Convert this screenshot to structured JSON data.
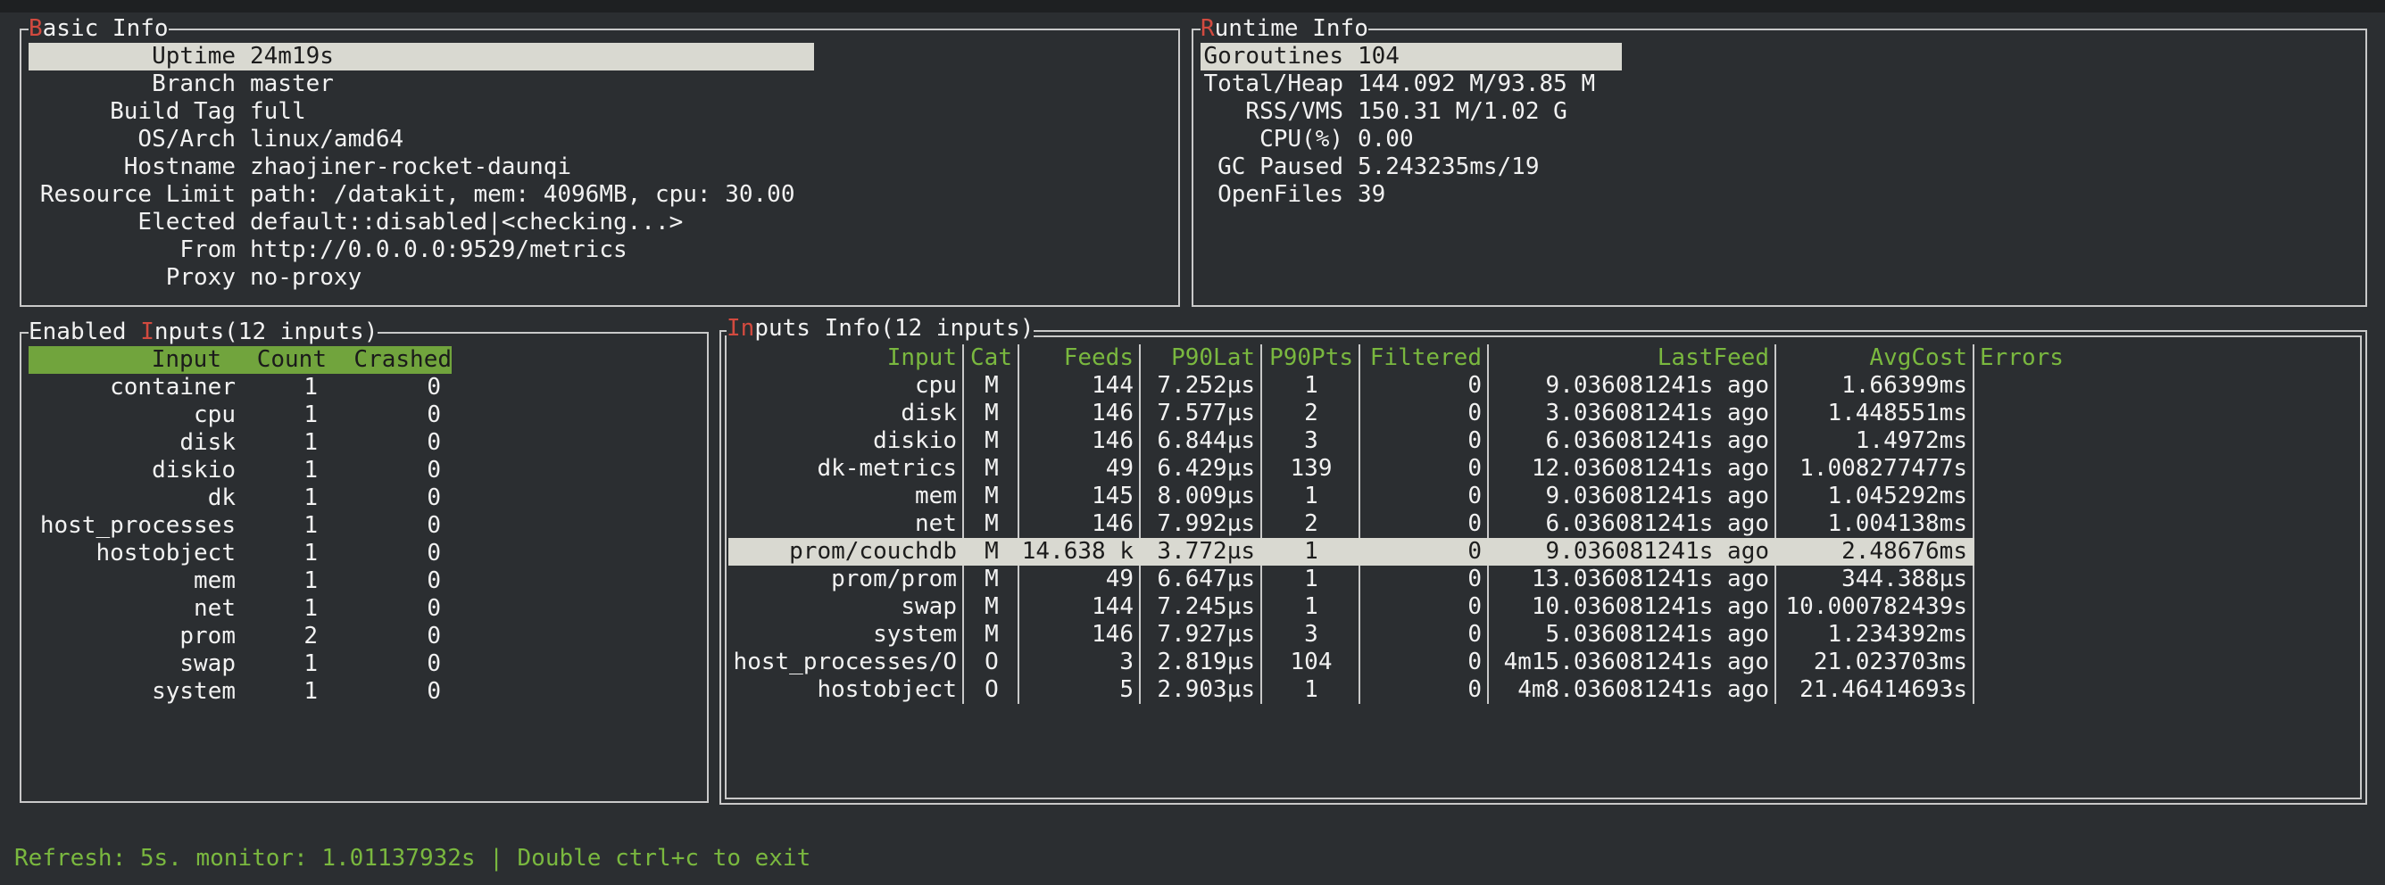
{
  "basic_info": {
    "title_hot": "B",
    "title_rest": "asic Info",
    "rows": [
      {
        "label": "Uptime",
        "value": "24m19s"
      },
      {
        "label": "Branch",
        "value": "master"
      },
      {
        "label": "Build Tag",
        "value": "full"
      },
      {
        "label": "OS/Arch",
        "value": "linux/amd64"
      },
      {
        "label": "Hostname",
        "value": "zhaojiner-rocket-daunqi"
      },
      {
        "label": "Resource Limit",
        "value": "path: /datakit, mem: 4096MB, cpu: 30.00"
      },
      {
        "label": "Elected",
        "value": "default::disabled|<checking...>"
      },
      {
        "label": "From",
        "value": "http://0.0.0.0:9529/metrics"
      },
      {
        "label": "Proxy",
        "value": "no-proxy"
      }
    ]
  },
  "runtime_info": {
    "title_hot": "R",
    "title_rest": "untime Info",
    "rows": [
      {
        "label": "Goroutines",
        "value": "104"
      },
      {
        "label": "Total/Heap",
        "value": "144.092 M/93.85 M"
      },
      {
        "label": "RSS/VMS",
        "value": "150.31 M/1.02 G"
      },
      {
        "label": "CPU(%)",
        "value": "0.00"
      },
      {
        "label": "GC Paused",
        "value": "5.243235ms/19"
      },
      {
        "label": "OpenFiles",
        "value": "39"
      }
    ]
  },
  "enabled_inputs": {
    "title_pre": "Enabled ",
    "title_hot": "I",
    "title_rest": "nputs(12 inputs)",
    "headers": [
      "Input",
      "Count",
      "Crashed"
    ],
    "rows": [
      [
        "container",
        "1",
        "0"
      ],
      [
        "cpu",
        "1",
        "0"
      ],
      [
        "disk",
        "1",
        "0"
      ],
      [
        "diskio",
        "1",
        "0"
      ],
      [
        "dk",
        "1",
        "0"
      ],
      [
        "host_processes",
        "1",
        "0"
      ],
      [
        "hostobject",
        "1",
        "0"
      ],
      [
        "mem",
        "1",
        "0"
      ],
      [
        "net",
        "1",
        "0"
      ],
      [
        "prom",
        "2",
        "0"
      ],
      [
        "swap",
        "1",
        "0"
      ],
      [
        "system",
        "1",
        "0"
      ]
    ]
  },
  "inputs_info": {
    "title_hot": "In",
    "title_rest": "puts Info(12 inputs)",
    "headers": [
      "Input",
      "Cat",
      "Feeds",
      "P90Lat",
      "P90Pts",
      "Filtered",
      "LastFeed",
      "AvgCost",
      "Errors"
    ],
    "selected_row": 6,
    "rows": [
      [
        "cpu",
        "M",
        "144",
        "7.252µs",
        "1",
        "0",
        "9.036081241s ago",
        "1.66399ms",
        ""
      ],
      [
        "disk",
        "M",
        "146",
        "7.577µs",
        "2",
        "0",
        "3.036081241s ago",
        "1.448551ms",
        ""
      ],
      [
        "diskio",
        "M",
        "146",
        "6.844µs",
        "3",
        "0",
        "6.036081241s ago",
        "1.4972ms",
        ""
      ],
      [
        "dk-metrics",
        "M",
        "49",
        "6.429µs",
        "139",
        "0",
        "12.036081241s ago",
        "1.008277477s",
        ""
      ],
      [
        "mem",
        "M",
        "145",
        "8.009µs",
        "1",
        "0",
        "9.036081241s ago",
        "1.045292ms",
        ""
      ],
      [
        "net",
        "M",
        "146",
        "7.992µs",
        "2",
        "0",
        "6.036081241s ago",
        "1.004138ms",
        ""
      ],
      [
        "prom/couchdb",
        "M",
        "14.638 k",
        "3.772µs",
        "1",
        "0",
        "9.036081241s ago",
        "2.48676ms",
        ""
      ],
      [
        "prom/prom",
        "M",
        "49",
        "6.647µs",
        "1",
        "0",
        "13.036081241s ago",
        "344.388µs",
        ""
      ],
      [
        "swap",
        "M",
        "144",
        "7.245µs",
        "1",
        "0",
        "10.036081241s ago",
        "10.000782439s",
        ""
      ],
      [
        "system",
        "M",
        "146",
        "7.927µs",
        "3",
        "0",
        "5.036081241s ago",
        "1.234392ms",
        ""
      ],
      [
        "host_processes/O",
        "O",
        "3",
        "2.819µs",
        "104",
        "0",
        "4m15.036081241s ago",
        "21.023703ms",
        ""
      ],
      [
        "hostobject",
        "O",
        "5",
        "2.903µs",
        "1",
        "0",
        "4m8.036081241s ago",
        "21.46414693s",
        ""
      ]
    ]
  },
  "footer": {
    "text": "Refresh: 5s. monitor: 1.01137932s | Double ctrl+c to exit"
  }
}
